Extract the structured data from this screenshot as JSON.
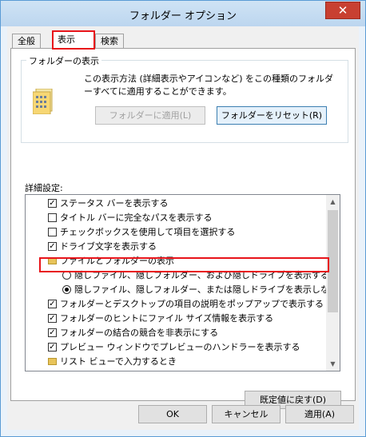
{
  "window": {
    "title": "フォルダー オプション",
    "close_glyph": "✕"
  },
  "tabs": [
    {
      "label": "全般"
    },
    {
      "label": "表示"
    },
    {
      "label": "検索"
    }
  ],
  "folder_view": {
    "group_title": "フォルダーの表示",
    "description": "この表示方法 (詳細表示やアイコンなど) をこの種類のフォルダーすべてに適用することができます。",
    "apply_button": "フォルダーに適用(L)",
    "reset_button": "フォルダーをリセット(R)"
  },
  "advanced": {
    "label": "詳細設定:",
    "items": [
      {
        "type": "checkbox",
        "checked": true,
        "indent": 0,
        "label": "ステータス バーを表示する"
      },
      {
        "type": "checkbox",
        "checked": false,
        "indent": 0,
        "label": "タイトル バーに完全なパスを表示する"
      },
      {
        "type": "checkbox",
        "checked": false,
        "indent": 0,
        "label": "チェックボックスを使用して項目を選択する"
      },
      {
        "type": "checkbox",
        "checked": true,
        "indent": 0,
        "label": "ドライブ文字を表示する"
      },
      {
        "type": "folder",
        "checked": false,
        "indent": 0,
        "label": "ファイルとフォルダーの表示"
      },
      {
        "type": "radio",
        "checked": false,
        "indent": 1,
        "label": "隠しファイル、隠しフォルダー、および隠しドライブを表示する"
      },
      {
        "type": "radio",
        "checked": true,
        "indent": 1,
        "label": "隠しファイル、隠しフォルダー、または隠しドライブを表示しない"
      },
      {
        "type": "checkbox",
        "checked": true,
        "indent": 0,
        "label": "フォルダーとデスクトップの項目の説明をポップアップで表示する"
      },
      {
        "type": "checkbox",
        "checked": true,
        "indent": 0,
        "label": "フォルダーのヒントにファイル サイズ情報を表示する"
      },
      {
        "type": "checkbox",
        "checked": true,
        "indent": 0,
        "label": "フォルダーの結合の競合を非表示にする"
      },
      {
        "type": "checkbox",
        "checked": true,
        "indent": 0,
        "label": "プレビュー ウィンドウでプレビューのハンドラーを表示する"
      },
      {
        "type": "folder",
        "checked": false,
        "indent": 0,
        "label": "リスト ビューで入力するとき"
      }
    ]
  },
  "restore_defaults_button": "既定値に戻す(D)",
  "footer": {
    "ok": "OK",
    "cancel": "キャンセル",
    "apply": "適用(A)"
  },
  "colors": {
    "highlight": "#e8141a",
    "close": "#c84031",
    "accent": "#5a9bd5"
  }
}
